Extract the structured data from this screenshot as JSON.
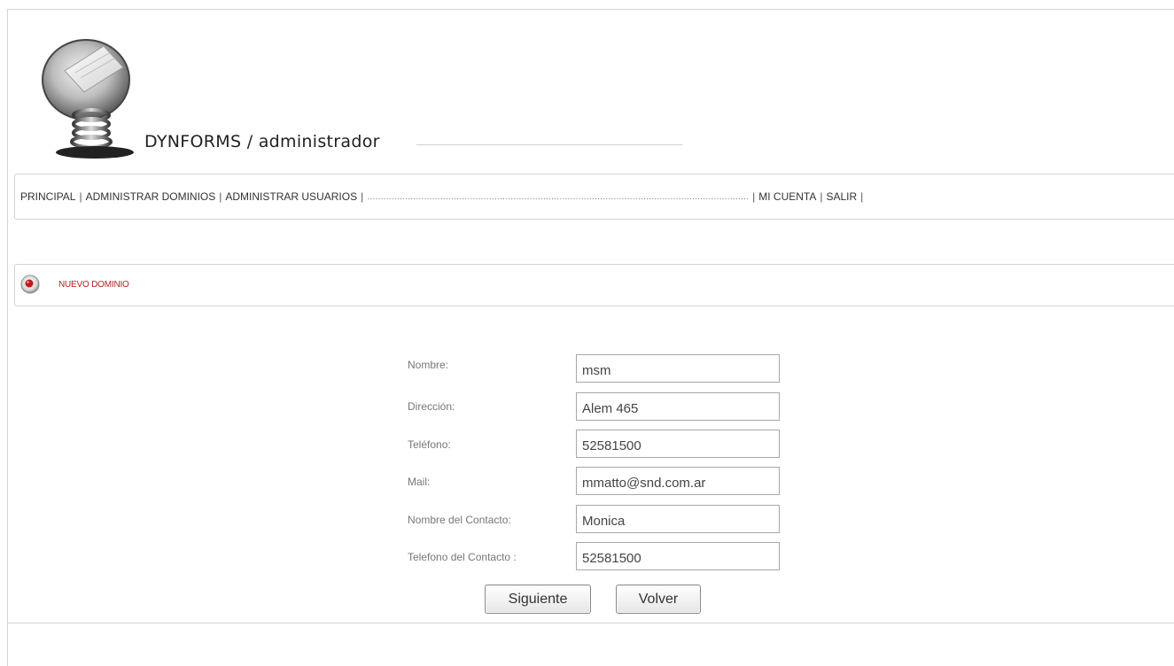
{
  "header": {
    "app_title": "DYNFORMS / administrador",
    "logo_icon": "server-spring-icon"
  },
  "nav": {
    "items": [
      {
        "label": "PRINCIPAL"
      },
      {
        "label": "ADMINISTRAR DOMINIOS"
      },
      {
        "label": "ADMINISTRAR USUARIOS"
      },
      {
        "label": "MI CUENTA"
      },
      {
        "label": "SALIR"
      }
    ],
    "separator": "|",
    "filler": "............................................................................................................................................."
  },
  "section": {
    "title": "NUEVO DOMINIO",
    "icon": "red-record-icon",
    "accent_color": "#b72020"
  },
  "form": {
    "fields": [
      {
        "label": "Nombre:",
        "value": "msm"
      },
      {
        "label": "Dirección:",
        "value": "Alem 465"
      },
      {
        "label": "Teléfono:",
        "value": "52581500"
      },
      {
        "label": "Mail:",
        "value": "mmatto@snd.com.ar"
      },
      {
        "label": "Nombre del Contacto:",
        "value": "Monica"
      },
      {
        "label": "Telefono del Contacto :",
        "value": "52581500"
      }
    ],
    "next_label": "Siguiente",
    "back_label": "Volver"
  }
}
